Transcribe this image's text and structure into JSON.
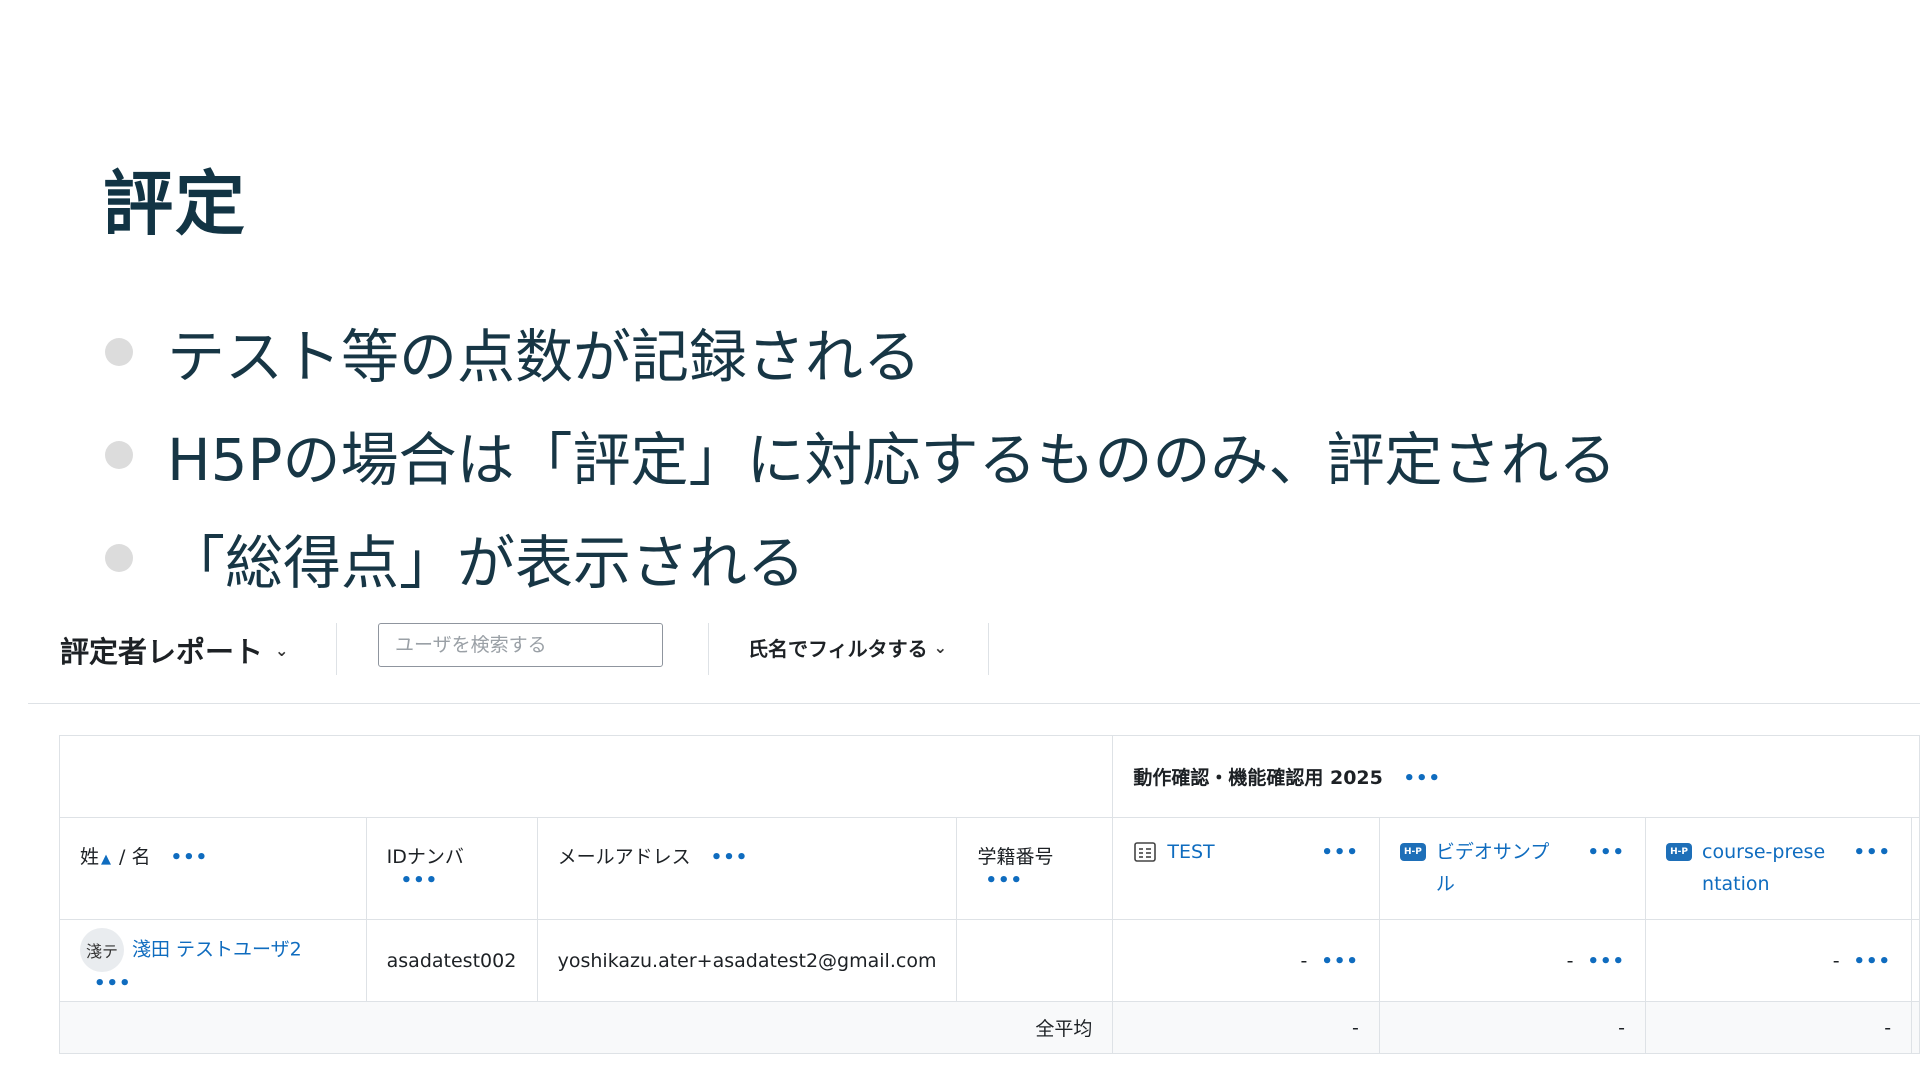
{
  "slide": {
    "title": "評定",
    "bullets": [
      "テスト等の点数が記録される",
      "H5Pの場合は「評定」に対応するもののみ、評定される",
      "「総得点」が表示される"
    ]
  },
  "toolbar": {
    "report_label": "評定者レポート",
    "search_placeholder": "ユーザを検索する",
    "name_filter_label": "氏名でフィルタする"
  },
  "grader": {
    "category_title": "動作確認・機能確認用 2025",
    "columns": {
      "lastname": "姓",
      "firstname": "名",
      "idnumber": "IDナンバ",
      "email": "メールアドレス",
      "student_no": "学籍番号"
    },
    "items": [
      {
        "name": "TEST",
        "icon": "quiz-icon"
      },
      {
        "name": "ビデオサンプル",
        "icon": "h5p-icon"
      },
      {
        "name": "course-presentation",
        "icon": "h5p-icon"
      }
    ],
    "h5p_badge": "H-P",
    "rows": [
      {
        "avatar_initials": "淺テ",
        "fullname": "淺田 テストユーザ2",
        "idnumber": "asadatest002",
        "email": "yoshikazu.ater+asadatest2@gmail.com",
        "student_no": "",
        "grades": [
          "-",
          "-",
          "-"
        ]
      }
    ],
    "average_label": "全平均",
    "averages": [
      "-",
      "-",
      "-"
    ],
    "more_glyph": "•••"
  },
  "colors": {
    "title": "#123444",
    "link": "#0f6cbf",
    "bullet_dot": "#dcdcdc",
    "border": "#dee2e6"
  }
}
